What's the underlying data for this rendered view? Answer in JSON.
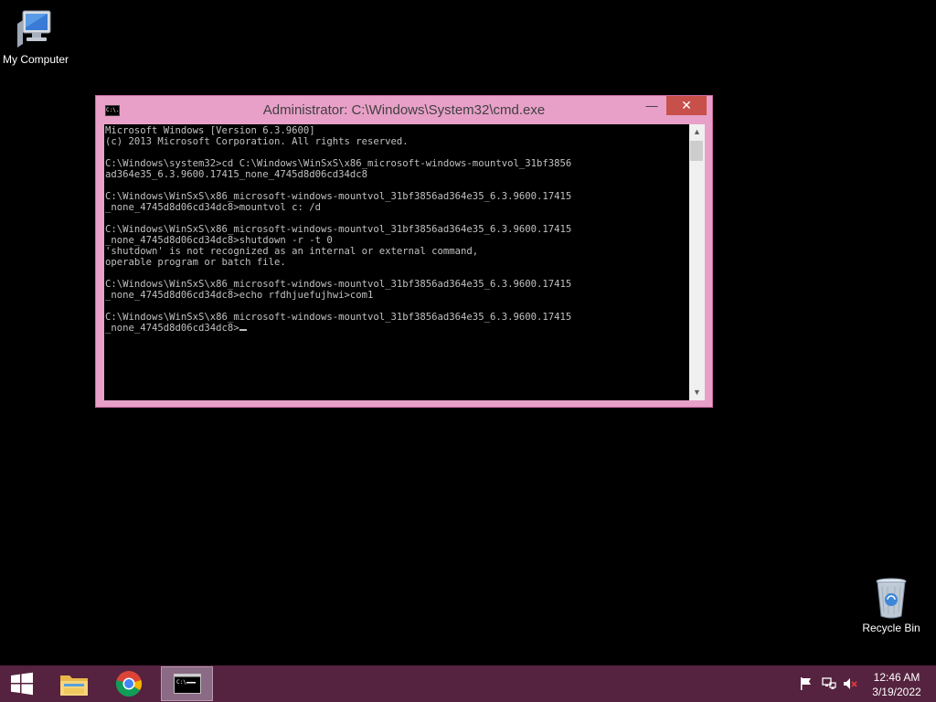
{
  "desktop": {
    "icons": [
      {
        "label": "My Computer",
        "icon": "computer-icon"
      },
      {
        "label": "Recycle Bin",
        "icon": "recycle-bin-icon"
      }
    ]
  },
  "window": {
    "title": "Administrator: C:\\Windows\\System32\\cmd.exe",
    "icon_text": "C:\\.",
    "buttons": {
      "minimize": "—",
      "maximize": "□",
      "close": "✕"
    },
    "console_lines": [
      "Microsoft Windows [Version 6.3.9600]",
      "(c) 2013 Microsoft Corporation. All rights reserved.",
      "",
      "C:\\Windows\\system32>cd C:\\Windows\\WinSxS\\x86_microsoft-windows-mountvol_31bf3856",
      "ad364e35_6.3.9600.17415_none_4745d8d06cd34dc8",
      "",
      "C:\\Windows\\WinSxS\\x86_microsoft-windows-mountvol_31bf3856ad364e35_6.3.9600.17415",
      "_none_4745d8d06cd34dc8>mountvol c: /d",
      "",
      "C:\\Windows\\WinSxS\\x86_microsoft-windows-mountvol_31bf3856ad364e35_6.3.9600.17415",
      "_none_4745d8d06cd34dc8>shutdown -r -t 0",
      "'shutdown' is not recognized as an internal or external command,",
      "operable program or batch file.",
      "",
      "C:\\Windows\\WinSxS\\x86_microsoft-windows-mountvol_31bf3856ad364e35_6.3.9600.17415",
      "_none_4745d8d06cd34dc8>echo rfdhjuefujhwi>com1",
      "",
      "C:\\Windows\\WinSxS\\x86_microsoft-windows-mountvol_31bf3856ad364e35_6.3.9600.17415",
      "_none_4745d8d06cd34dc8>"
    ],
    "colors": {
      "frame": "#e8a0c8",
      "console_bg": "#000000",
      "console_text": "#c0c0c0",
      "close": "#c7504b"
    }
  },
  "taskbar": {
    "items": [
      {
        "name": "start",
        "icon": "windows-logo-icon"
      },
      {
        "name": "file-explorer",
        "icon": "folder-icon"
      },
      {
        "name": "chrome",
        "icon": "chrome-icon"
      },
      {
        "name": "cmd",
        "icon": "cmd-icon",
        "active": true
      }
    ],
    "tray": [
      "flag-icon",
      "network-icon",
      "volume-muted-icon"
    ],
    "clock": {
      "time": "12:46 AM",
      "date": "3/19/2022"
    },
    "color": "#55233f"
  }
}
